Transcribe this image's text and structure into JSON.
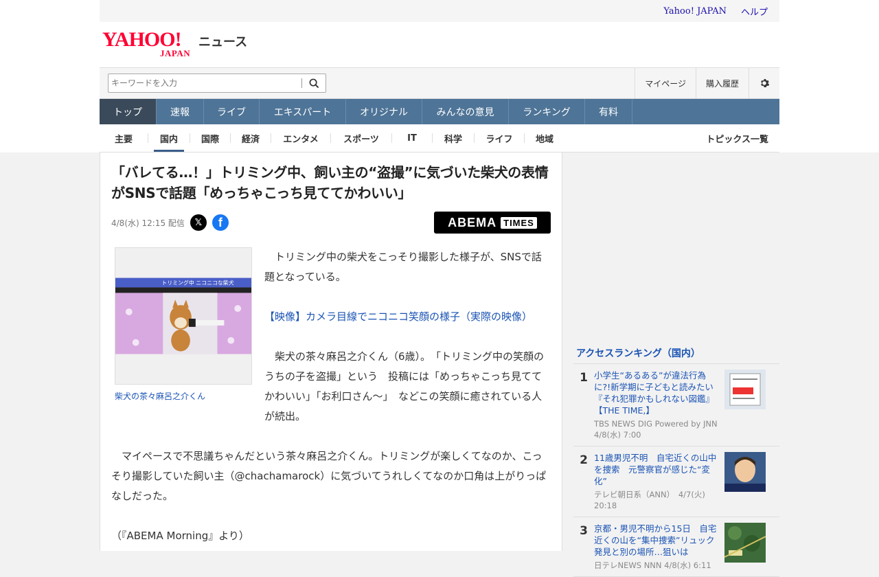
{
  "utility": {
    "yahoo_japan": "Yahoo! JAPAN",
    "help": "ヘルプ"
  },
  "brand": {
    "logo_yahoo": "YAHOO!",
    "logo_japan": "JAPAN",
    "service": "ニュース"
  },
  "search": {
    "placeholder": "キーワードを入力"
  },
  "account": {
    "mypage": "マイページ",
    "history": "購入履歴"
  },
  "global_nav": [
    "トップ",
    "速報",
    "ライブ",
    "エキスパート",
    "オリジナル",
    "みんなの意見",
    "ランキング",
    "有料"
  ],
  "sub_nav": [
    "主要",
    "国内",
    "国際",
    "経済",
    "エンタメ",
    "スポーツ",
    "IT",
    "科学",
    "ライフ",
    "地域"
  ],
  "sub_nav_active": "国内",
  "topics_all": "トピックス一覧",
  "article": {
    "title": "「バレてる…！」トリミング中、飼い主の“盗撮”に気づいた柴犬の表情がSNSで話題「めっちゃこっち見ててかわいい」",
    "date": "4/8(水) 12:15 配信",
    "publisher_main": "ABEMA",
    "publisher_sub": "TIMES",
    "image_caption": "柴犬の茶々麻呂之介くん",
    "image_banner": "トリミング中 ニコニコな柴犬",
    "para1": "　トリミング中の柴犬をこっそり撮影した様子が、SNSで話題となっている。",
    "link": "【映像】カメラ目線でニコニコ笑顔の様子（実際の映像）",
    "para2": "　柴犬の茶々麻呂之介くん（6歳）。　「トリミング中の笑顔のうちの子を盗撮」という　投稿には「めっちゃこっち見ててかわいい」「お利口さん〜」　などこの笑顔に癒されている人が続出。",
    "para3": "　マイペースで不思議ちゃんだという茶々麻呂之介くん。トリミングが楽しくてなのか、こっそり撮影していた飼い主（@chachamarock）に気づいてうれしくてなのか口角は上がりっぱなしだった。",
    "para4": "（『ABEMA Morning』より）"
  },
  "ranking": {
    "title": "アクセスランキング（国内）",
    "items": [
      {
        "rank": "1",
        "title": "小学生“あるある”が違法行為に?!新学期に子どもと読みたい『それ犯罪かもしれない図鑑』【THE TIME,】",
        "source": "TBS NEWS DIG Powered by JNN",
        "time": "4/8(水) 7:00"
      },
      {
        "rank": "2",
        "title": "11歳男児不明　自宅近くの山中を捜索　元警察官が感じた“変化”",
        "source": "テレビ朝日系（ANN）",
        "time": "4/7(火) 20:18"
      },
      {
        "rank": "3",
        "title": "京都・男児不明から15日　自宅近くの山を“集中捜索”リュック発見と別の場所…狙いは",
        "source": "日テレNEWS NNN",
        "time": "4/8(水) 6:11"
      }
    ]
  },
  "colors": {
    "nav_bg": "#4e7497",
    "link": "#1a53b4",
    "brand_red": "#ff0033"
  }
}
